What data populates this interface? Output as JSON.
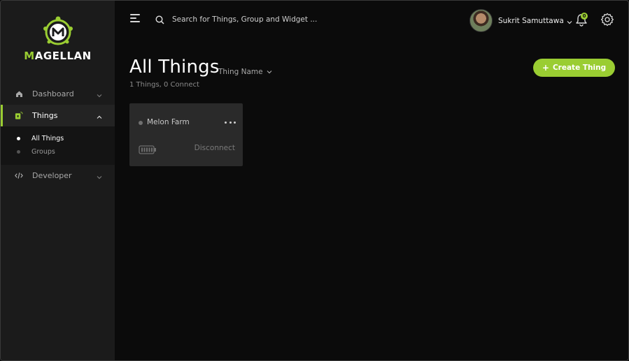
{
  "brand": {
    "logo_text_first": "M",
    "logo_text_rest": "AGELLAN",
    "accent_color": "#9acd32"
  },
  "sidebar": {
    "items": [
      {
        "label": "Dashboard",
        "icon": "home-icon",
        "expanded": false
      },
      {
        "label": "Things",
        "icon": "thing-icon",
        "expanded": true,
        "active": true
      },
      {
        "label": "Developer",
        "icon": "code-icon",
        "expanded": false
      }
    ],
    "things_sub": [
      {
        "label": "All Things",
        "active": true
      },
      {
        "label": "Groups",
        "active": false
      }
    ]
  },
  "topbar": {
    "search_placeholder": "Search for Things, Group and Widget ...",
    "user_name": "Sukrit Samuttawa",
    "notification_count": "0"
  },
  "main": {
    "title": "All Things",
    "sort_label": "Thing Name",
    "summary": "1 Things, 0 Connect",
    "create_label": "Create Thing",
    "cards": [
      {
        "name": "Melon Farm",
        "status": "Disconnect",
        "status_color": "#707070"
      }
    ]
  }
}
